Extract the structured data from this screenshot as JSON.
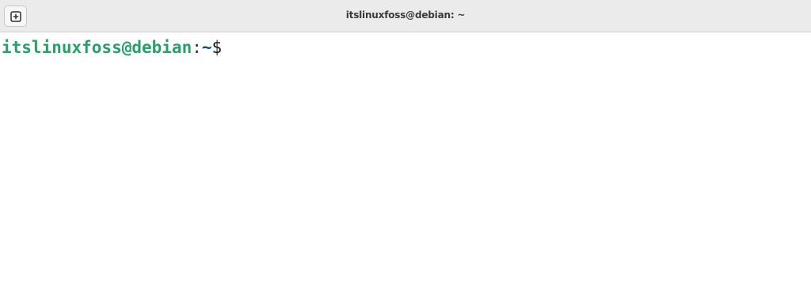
{
  "window": {
    "title": "itslinuxfoss@debian: ~"
  },
  "headerbar": {
    "new_tab_icon": "plus-square-icon"
  },
  "terminal": {
    "prompt": {
      "user_host": "itslinuxfoss@debian",
      "separator": ":",
      "path": "~",
      "symbol": "$"
    }
  },
  "colors": {
    "user_host": "#26a269",
    "path": "#12488b",
    "headerbar_bg": "#ebebeb",
    "terminal_bg": "#ffffff"
  }
}
